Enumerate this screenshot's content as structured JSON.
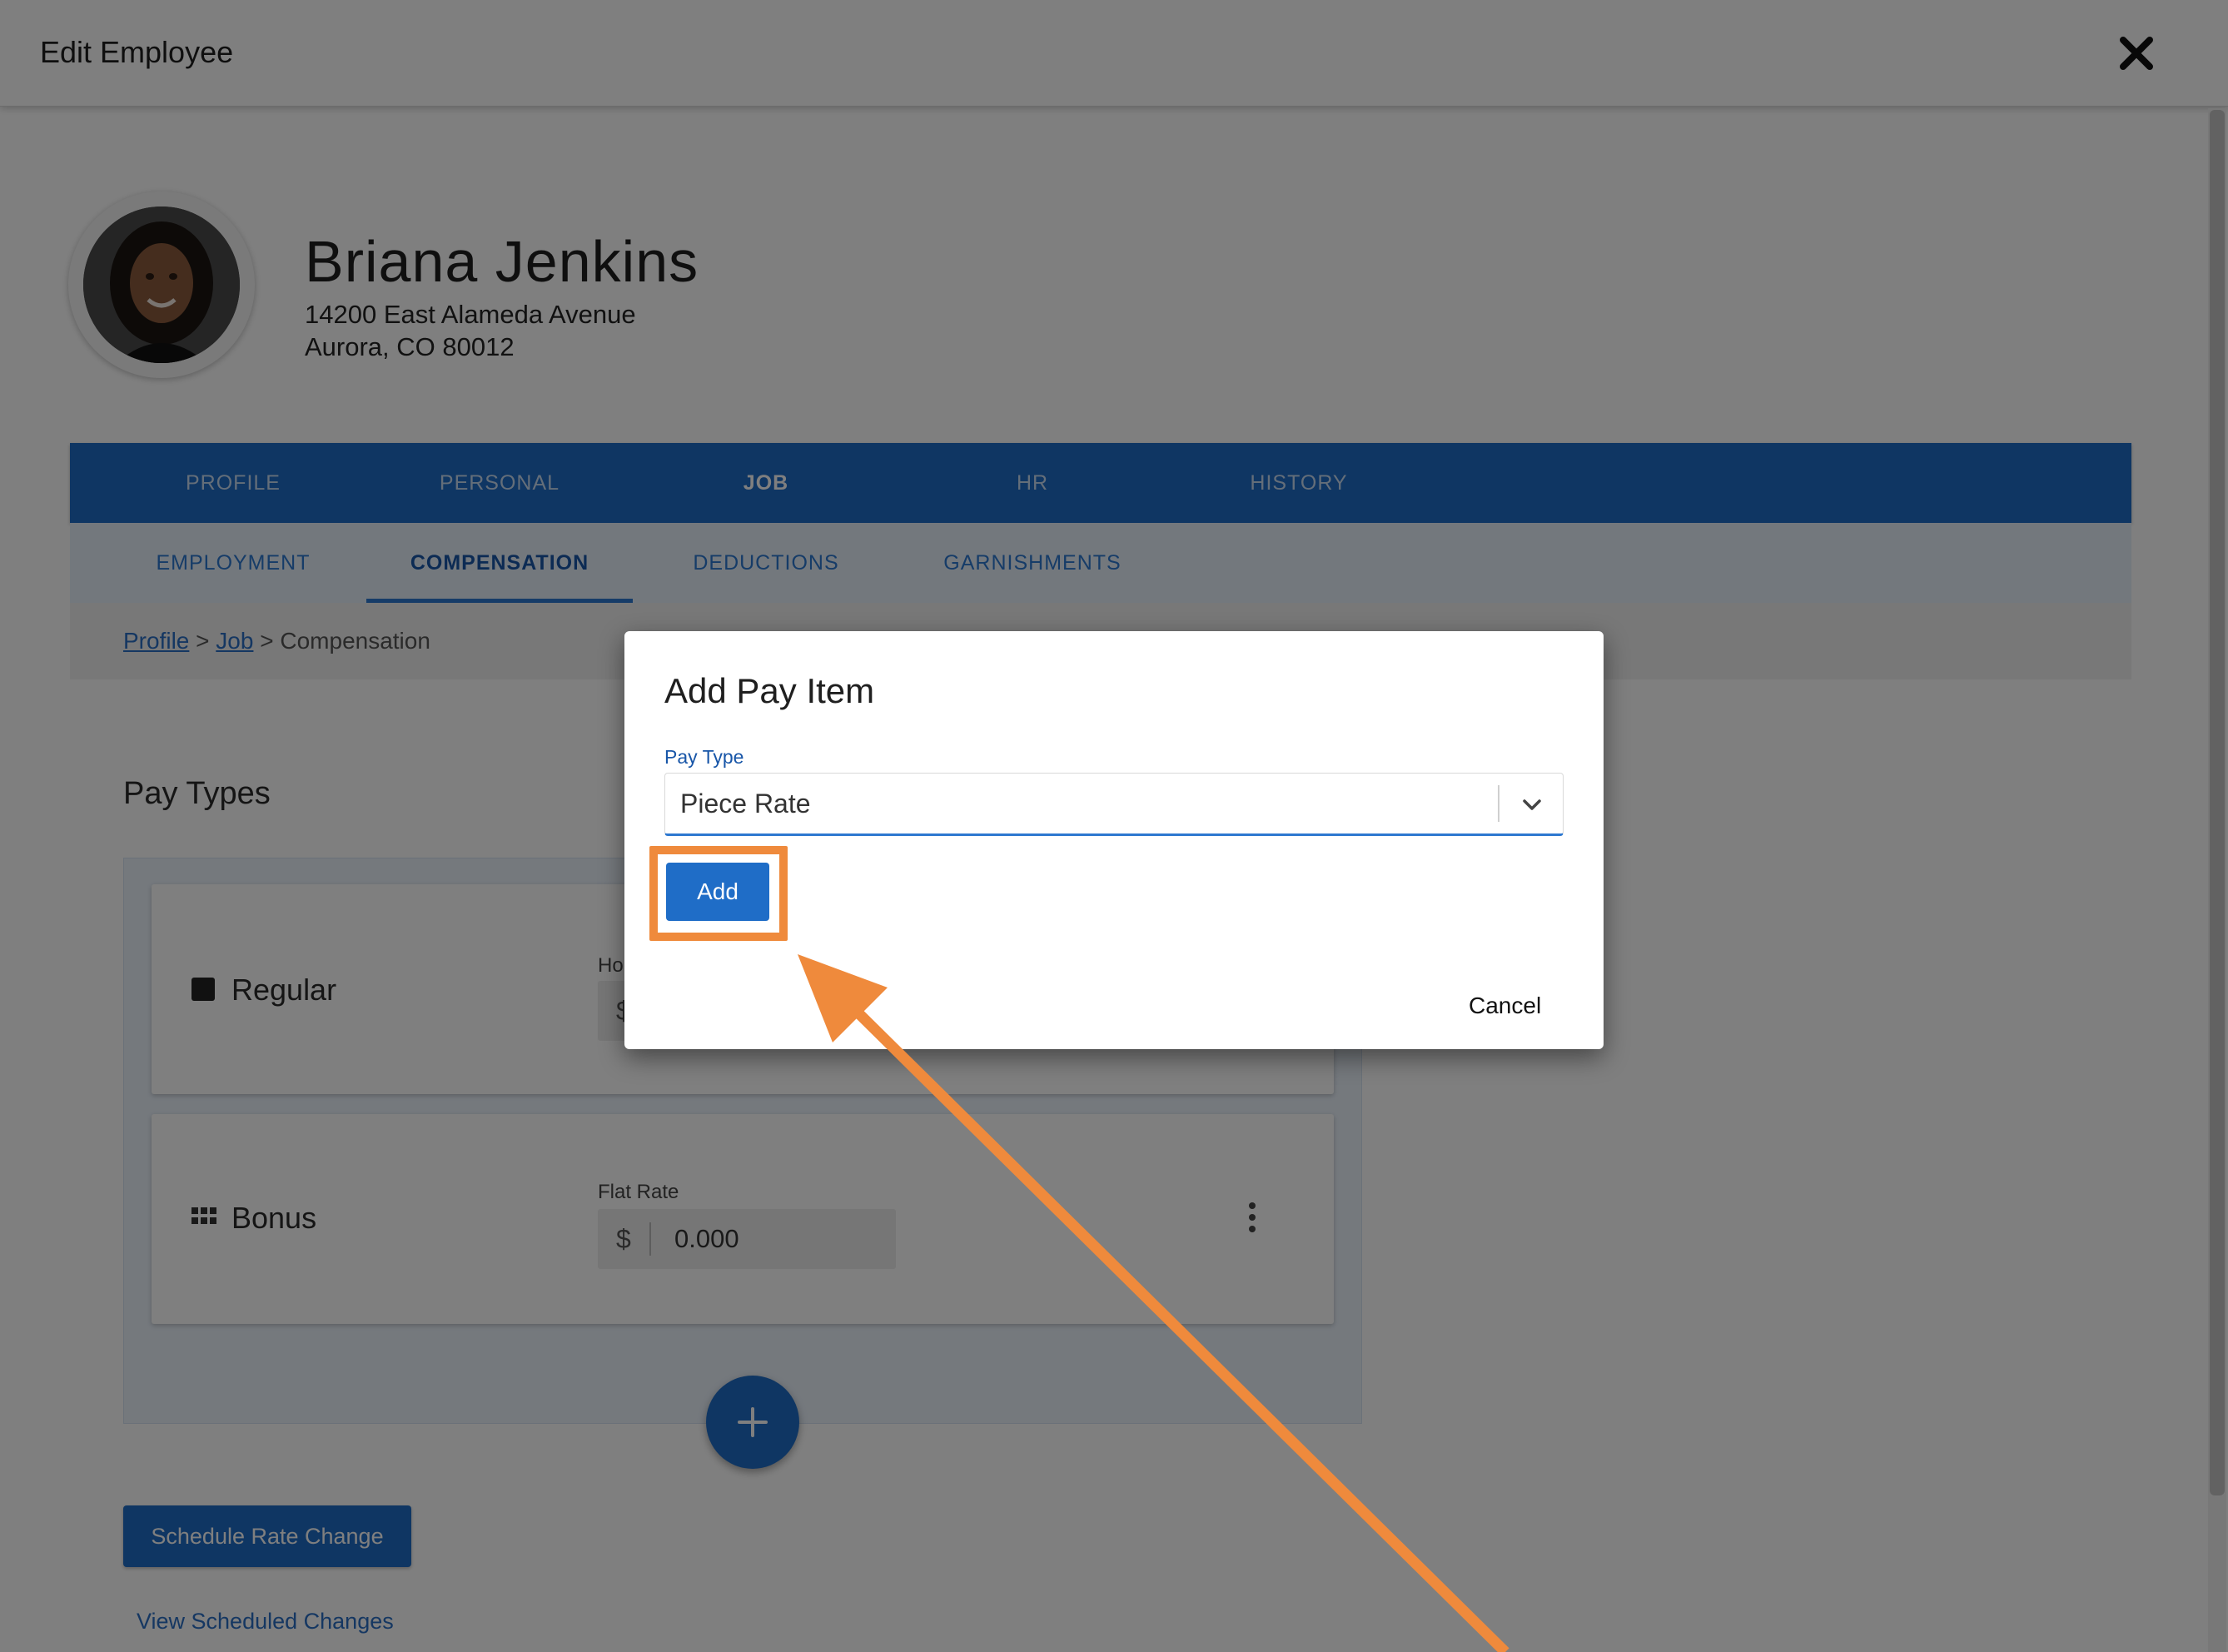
{
  "header": {
    "title": "Edit Employee",
    "close_icon": "close-icon"
  },
  "employee": {
    "name": "Briana Jenkins",
    "address_line1": "14200 East Alameda Avenue",
    "address_line2": "Aurora, CO 80012"
  },
  "main_tabs": [
    {
      "label": "PROFILE",
      "active": false
    },
    {
      "label": "PERSONAL",
      "active": false
    },
    {
      "label": "JOB",
      "active": true
    },
    {
      "label": "HR",
      "active": false
    },
    {
      "label": "HISTORY",
      "active": false
    }
  ],
  "sub_tabs": [
    {
      "label": "EMPLOYMENT",
      "active": false
    },
    {
      "label": "COMPENSATION",
      "active": true
    },
    {
      "label": "DEDUCTIONS",
      "active": false
    },
    {
      "label": "GARNISHMENTS",
      "active": false
    }
  ],
  "breadcrumb": {
    "link1": "Profile",
    "sep": ">",
    "link2": "Job",
    "current": "Compensation"
  },
  "pay_types": {
    "title": "Pay Types",
    "items": [
      {
        "name": "Regular",
        "field_label": "Ho",
        "currency": "$",
        "value": ""
      },
      {
        "name": "Bonus",
        "field_label": "Flat Rate",
        "currency": "$",
        "value": "0.000"
      }
    ]
  },
  "buttons": {
    "schedule": "Schedule Rate Change",
    "view_scheduled": "View Scheduled Changes"
  },
  "dialog": {
    "title": "Add Pay Item",
    "pay_type_label": "Pay Type",
    "pay_type_value": "Piece Rate",
    "add_label": "Add",
    "cancel_label": "Cancel"
  },
  "colors": {
    "brand_blue": "#1f6dc7",
    "highlight_orange": "#ef8a3c",
    "scrim": "rgba(0,0,0,0.5)"
  }
}
